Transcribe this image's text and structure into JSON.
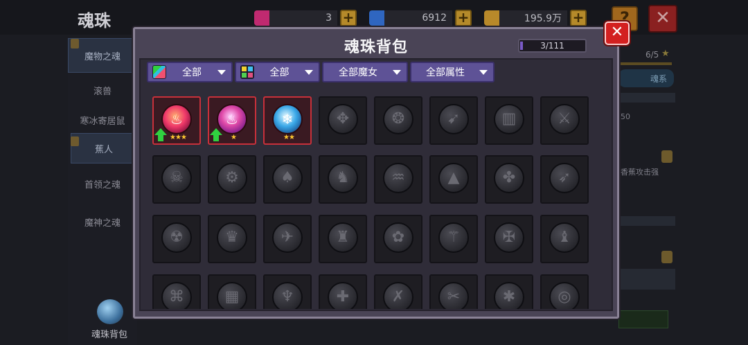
{
  "background": {
    "title": "魂珠",
    "resources": [
      {
        "name": "pink-gem",
        "value": "3",
        "color": "#d0307a"
      },
      {
        "name": "blue-gem",
        "value": "6912",
        "color": "#3a7ad8"
      },
      {
        "name": "gold",
        "value": "195.9万",
        "color": "#c89a2a"
      }
    ],
    "help_label": "?",
    "close_label": "✕",
    "sidebar": [
      {
        "label": "魔物之魂",
        "selected": true
      },
      {
        "label": "滚兽",
        "selected": false
      },
      {
        "label": "寒冰寄居鼠",
        "selected": false
      },
      {
        "label": "蕉人",
        "selected": true
      },
      {
        "label": "首领之魂",
        "selected": false
      },
      {
        "label": "魔神之魂",
        "selected": false
      }
    ],
    "sidebar_pack_label": "魂珠背包",
    "right_panel": {
      "count": "6/5",
      "tag": "魂系",
      "line1": "50",
      "line2": "香蕉攻击强"
    }
  },
  "modal": {
    "title": "魂珠背包",
    "capacity": "3/111",
    "close_label": "✕",
    "filters": [
      {
        "label": "全部",
        "icon": "rainbow-color-icon",
        "has_icon": true
      },
      {
        "label": "全部",
        "icon": "color-grid-icon",
        "has_icon": true
      },
      {
        "label": "全部魔女",
        "has_icon": false
      },
      {
        "label": "全部属性",
        "has_icon": false
      }
    ],
    "owned_items": [
      {
        "icon": "red-demon-soul-icon",
        "glyph": "♨",
        "stars": "★★★",
        "upgrade": true
      },
      {
        "icon": "pink-demon-soul-icon",
        "glyph": "♨",
        "stars": "★",
        "upgrade": true
      },
      {
        "icon": "blue-ice-soul-icon",
        "glyph": "❄",
        "stars": "★★",
        "upgrade": false
      }
    ],
    "locked_items": [
      {
        "icon": "axe-soul-icon",
        "glyph": "✥"
      },
      {
        "icon": "swirl-soul-icon",
        "glyph": "❂"
      },
      {
        "icon": "feather-soul-icon",
        "glyph": "➹"
      },
      {
        "icon": "tablet-soul-icon",
        "glyph": "▥"
      },
      {
        "icon": "sword-soul-icon",
        "glyph": "⚔"
      },
      {
        "icon": "beast-soul-icon",
        "glyph": "☠"
      },
      {
        "icon": "gear-soul-icon",
        "glyph": "⚙"
      },
      {
        "icon": "ghost-soul-icon",
        "glyph": "♠"
      },
      {
        "icon": "claw-soul-icon",
        "glyph": "♞"
      },
      {
        "icon": "wave-soul-icon",
        "glyph": "♒"
      },
      {
        "icon": "hat-soul-icon",
        "glyph": "▲"
      },
      {
        "icon": "knot-soul-icon",
        "glyph": "✤"
      },
      {
        "icon": "spear-soul-icon",
        "glyph": "➶"
      },
      {
        "icon": "skull-soul-icon",
        "glyph": "☢"
      },
      {
        "icon": "crown-soul-icon",
        "glyph": "♛"
      },
      {
        "icon": "wing-soul-icon",
        "glyph": "✈"
      },
      {
        "icon": "dragon-soul-icon",
        "glyph": "♜"
      },
      {
        "icon": "flower-soul-icon",
        "glyph": "✿"
      },
      {
        "icon": "staff-soul-icon",
        "glyph": "⚚"
      },
      {
        "icon": "chain-soul-icon",
        "glyph": "✠"
      },
      {
        "icon": "horn-soul-icon",
        "glyph": "♝"
      },
      {
        "icon": "rune-soul-icon",
        "glyph": "⌘"
      },
      {
        "icon": "maze-soul-icon",
        "glyph": "▦"
      },
      {
        "icon": "demon-soul-icon",
        "glyph": "♆"
      },
      {
        "icon": "cross-soul-icon",
        "glyph": "✚"
      },
      {
        "icon": "bone-soul-icon",
        "glyph": "✗"
      },
      {
        "icon": "blade-soul-icon",
        "glyph": "✂"
      },
      {
        "icon": "star-soul-icon",
        "glyph": "✱"
      },
      {
        "icon": "shell-soul-icon",
        "glyph": "◎"
      }
    ]
  }
}
